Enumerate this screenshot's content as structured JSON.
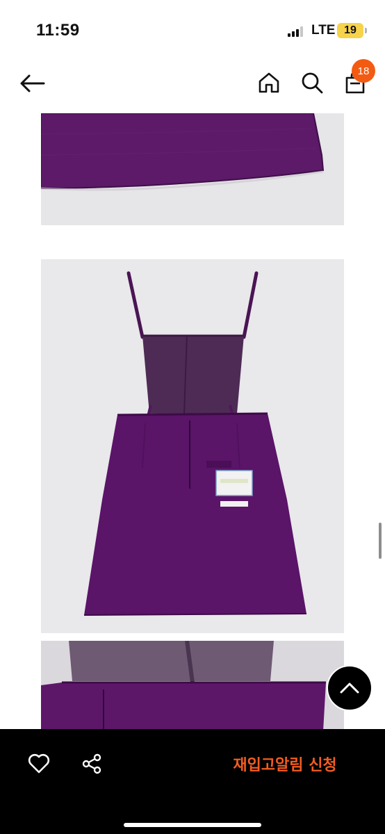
{
  "status_bar": {
    "time": "11:59",
    "network": "LTE",
    "battery": "19",
    "battery_color": "#f6d34a"
  },
  "header": {
    "back_icon": "arrow-left-icon",
    "home_icon": "home-icon",
    "search_icon": "search-icon",
    "cart_icon": "shopping-bag-icon",
    "cart_count": "18",
    "badge_color": "#f35b12"
  },
  "product_images": [
    {
      "description_icon": "product-photo",
      "subject": "purple skirt hem detail"
    },
    {
      "description_icon": "product-photo",
      "subject": "purple pinafore dress back view"
    },
    {
      "description_icon": "product-photo",
      "subject": "purple dress waist and zipper detail"
    }
  ],
  "scroll_top_icon": "chevron-up-icon",
  "bottom_bar": {
    "like_icon": "heart-icon",
    "share_icon": "share-icon",
    "restock_label": "재입고알림 신청",
    "accent_color": "#f35c21"
  }
}
